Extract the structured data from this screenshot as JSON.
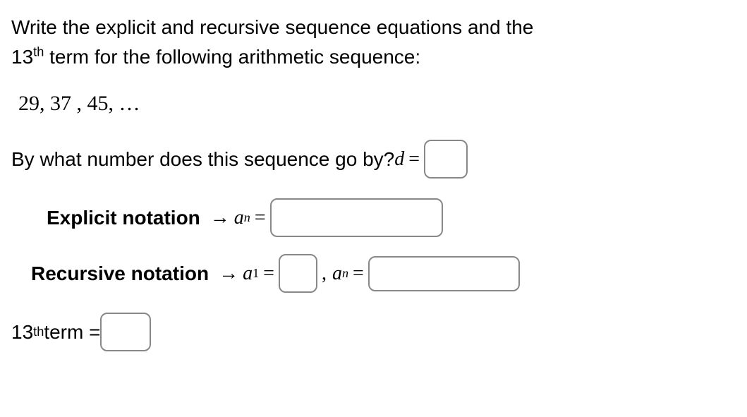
{
  "prompt_line1": "Write the explicit and recursive sequence equations and the",
  "prompt_13": "13",
  "prompt_th": "th",
  "prompt_line2": " term for the following arithmetic sequence:",
  "sequence": "29, 37 , 45, …",
  "question_d_text": "By what number does this sequence go by? ",
  "d_var": "d",
  "equals": " = ",
  "explicit_label": "Explicit notation",
  "arrow": "→",
  "a_var": "a",
  "sub_n": "n",
  "recursive_label": "Recursive notation",
  "sub_1": "1",
  "comma": ",",
  "term_13": "13",
  "term_th": "th",
  "term_label": " term = "
}
